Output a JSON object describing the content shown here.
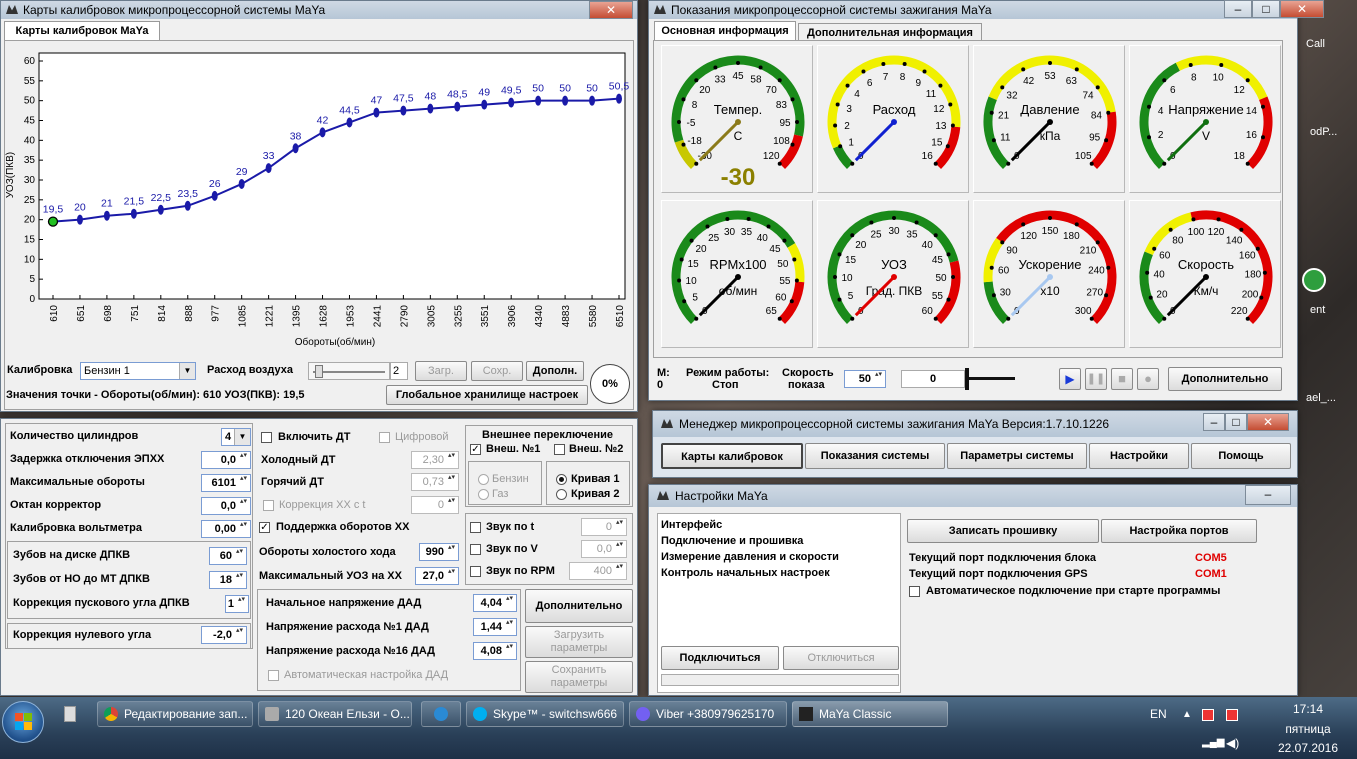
{
  "cal_window": {
    "title": "Карты калибровок микропроцессорной системы MaYa",
    "tab": "Карты калибровок MaYa",
    "ylabel": "УОЗ(ПКВ)",
    "xlabel": "Обороты(об/мин)",
    "calib_label": "Калибровка",
    "calib_value": "Бензин 1",
    "air_label": "Расход воздуха",
    "air_value": "2",
    "load_btn": "Загр.",
    "save_btn": "Сохр.",
    "more_btn": "Дополн.",
    "point_label": "Значения точки - Обороты(об/мин): 610   УОЗ(ПКВ): 19,5",
    "global_btn": "Глобальное хранилище настроек",
    "percent": "0%"
  },
  "chart_data": {
    "type": "line",
    "xlabel": "Обороты(об/мин)",
    "ylabel": "УОЗ(ПКВ)",
    "ylim": [
      0,
      60
    ],
    "yticks": [
      "0",
      "5",
      "10",
      "15",
      "20",
      "25",
      "30",
      "35",
      "40",
      "45",
      "50",
      "55",
      "60"
    ],
    "categories": [
      "610",
      "651",
      "698",
      "751",
      "814",
      "888",
      "977",
      "1085",
      "1221",
      "1395",
      "1628",
      "1953",
      "2441",
      "2790",
      "3005",
      "3255",
      "3551",
      "3906",
      "4340",
      "4883",
      "5580",
      "6510"
    ],
    "x": [
      610,
      651,
      698,
      751,
      814,
      888,
      977,
      1085,
      1221,
      1395,
      1628,
      1953,
      2441,
      2790,
      3005,
      3255,
      3551,
      3906,
      4340,
      4883,
      5580,
      6510
    ],
    "values": [
      19.5,
      20,
      21,
      21.5,
      22.5,
      23.5,
      26,
      29,
      33,
      38,
      42,
      44.5,
      47,
      47.5,
      48,
      48.5,
      49,
      49.5,
      50,
      50,
      50,
      50.5
    ],
    "labels": [
      "19,5",
      "20",
      "21",
      "21,5",
      "22,5",
      "23,5",
      "26",
      "29",
      "33",
      "38",
      "42",
      "44,5",
      "47",
      "47,5",
      "48",
      "48,5",
      "49",
      "49,5",
      "50",
      "50",
      "50",
      "50,5"
    ]
  },
  "sys_window": {
    "title": "Показания микропроцессорной системы зажигания MaYa",
    "tab1": "Основная информация",
    "tab2": "Дополнительная информация",
    "m_label": "M:",
    "m_value": "0",
    "mode_label": "Режим работы:",
    "mode_value": "Стоп",
    "speed_label": "Скорость",
    "speed_label2": "показа",
    "speed_value": "50",
    "slider_value": "0",
    "more_btn": "Дополнительно"
  },
  "gauges": [
    {
      "name": "Темпер.",
      "unit": "C",
      "ticks": [
        "-30",
        "-18",
        "-5",
        "8",
        "20",
        "33",
        "45",
        "58",
        "70",
        "83",
        "95",
        "108",
        "120"
      ],
      "value": -30,
      "readout": "-30",
      "color": "#8b7a1a"
    },
    {
      "name": "Расход",
      "unit": "",
      "ticks": [
        "0",
        "1",
        "2",
        "3",
        "4",
        "6",
        "7",
        "8",
        "9",
        "11",
        "12",
        "13",
        "15",
        "16"
      ],
      "value": 0,
      "color": "#1020d0"
    },
    {
      "name": "Давление",
      "unit": "кПа",
      "ticks": [
        "0",
        "11",
        "21",
        "32",
        "42",
        "53",
        "63",
        "74",
        "84",
        "95",
        "105"
      ],
      "value": 0,
      "color": "#000"
    },
    {
      "name": "Напряжение",
      "unit": "V",
      "ticks": [
        "0",
        "2",
        "4",
        "6",
        "8",
        "10",
        "12",
        "14",
        "16",
        "18"
      ],
      "value": 0,
      "color": "#107010"
    },
    {
      "name": "RPMx100",
      "unit": "об/мин",
      "ticks": [
        "0",
        "5",
        "10",
        "15",
        "20",
        "25",
        "30",
        "35",
        "40",
        "45",
        "50",
        "55",
        "60",
        "65"
      ],
      "value": 0,
      "color": "#000"
    },
    {
      "name": "УОЗ",
      "unit": "Град. ПКВ",
      "ticks": [
        "0",
        "5",
        "10",
        "15",
        "20",
        "25",
        "30",
        "35",
        "40",
        "45",
        "50",
        "55",
        "60"
      ],
      "value": 0,
      "color": "#e00000"
    },
    {
      "name": "Ускорение",
      "unit": "x10",
      "ticks": [
        "0",
        "30",
        "60",
        "90",
        "120",
        "150",
        "180",
        "210",
        "240",
        "270",
        "300"
      ],
      "value": 0,
      "color": "#a8c8f0"
    },
    {
      "name": "Скорость",
      "unit": "Км/ч",
      "ticks": [
        "0",
        "20",
        "40",
        "60",
        "80",
        "100",
        "120",
        "140",
        "160",
        "180",
        "200",
        "220"
      ],
      "value": 0,
      "color": "#000"
    }
  ],
  "manager": {
    "title": "Менеджер микропроцессорной системы зажигания MaYa  Версия:1.7.10.1226",
    "buttons": [
      "Карты калибровок",
      "Показания системы",
      "Параметры системы",
      "Настройки",
      "Помощь"
    ]
  },
  "settings": {
    "title": "Настройки MaYa",
    "items": [
      "Интерфейс",
      "Подключение и прошивка",
      "Измерение давления и скорости",
      "Контроль начальных настроек"
    ],
    "connect": "Подключиться",
    "disconnect": "Отключиться",
    "write_fw": "Записать прошивку",
    "ports_btn": "Настройка портов",
    "port_block_label": "Текущий порт подключения блока",
    "port_block": "COM5",
    "port_gps_label": "Текущий порт подключения GPS",
    "port_gps": "COM1",
    "auto": "Автоматическое подключение при старте программы"
  },
  "params": {
    "cyl_label": "Количество цилиндров",
    "cyl": "4",
    "epxx_label": "Задержка отключения ЭПХХ",
    "epxx": "0,0",
    "maxrpm_label": "Максимальные обороты",
    "maxrpm": "6101",
    "oct_label": "Октан корректор",
    "oct": "0,0",
    "volt_label": "Калибровка вольтметра",
    "volt": "0,00",
    "teeth_label": "Зубов на диске ДПКВ",
    "teeth": "60",
    "teeth2_label": "Зубов от НО до  МТ ДПКВ",
    "teeth2": "18",
    "start_label": "Коррекция пускового угла ДПКВ",
    "start": "1",
    "zero_label": "Коррекция нулевого угла",
    "zero": "-2,0",
    "dt_on": "Включить ДТ",
    "digital": "Цифровой",
    "cold_label": "Холодный ДТ",
    "cold": "2,30",
    "hot_label": "Горячий ДТ",
    "hot": "0,73",
    "corr_label": "Коррекция ХХ с t",
    "corr": "0",
    "xx_sup": "Поддержка оборотов ХХ",
    "idle_label": "Обороты холостого хода",
    "idle": "990",
    "maxuoz_label": "Максимальный УОЗ на ХХ",
    "maxuoz": "27,0",
    "ext_title": "Внешнее переключение",
    "ext1": "Внеш. №1",
    "ext2": "Внеш. №2",
    "petrol": "Бензин",
    "gas": "Газ",
    "curve1": "Кривая 1",
    "curve2": "Кривая 2",
    "snd_t": "Звук по t",
    "snd_t_v": "0",
    "snd_v": "Звук по V",
    "snd_v_v": "0,0",
    "snd_rpm": "Звук по RPM",
    "snd_rpm_v": "400",
    "dad_start_label": "Начальное напряжение ДАД",
    "dad_start": "4,04",
    "dad1_label": "Напряжение расхода №1 ДАД",
    "dad1": "1,44",
    "dad16_label": "Напряжение расхода №16 ДАД",
    "dad16": "4,08",
    "auto_dad": "Автоматическая настройка ДАД",
    "more": "Дополнительно",
    "load": "Загрузить параметры",
    "save": "Сохранить параметры"
  },
  "taskbar": {
    "tasks": [
      "Редактирование зап...",
      "120 Океан Ельзи - О...",
      "",
      "Skype™ - switchsw666",
      "Viber +380979625170",
      "MaYa Classic"
    ],
    "lang": "EN",
    "time": "17:14",
    "day": "пятница",
    "date": "22.07.2016"
  },
  "desktop": {
    "icons": [
      "Call",
      "odP...",
      "ent",
      "ael_..."
    ]
  }
}
